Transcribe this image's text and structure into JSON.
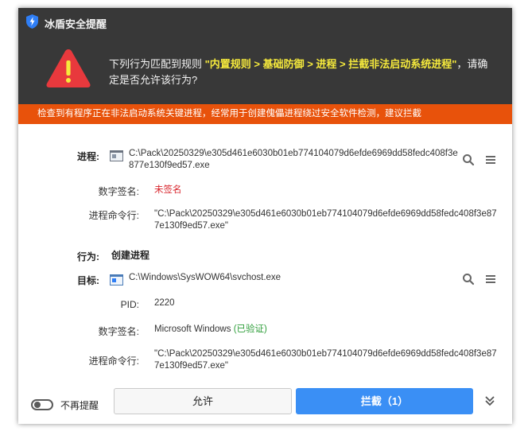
{
  "window": {
    "title": "冰盾安全提醒"
  },
  "header": {
    "msg_before": "下列行为匹配到规则 ",
    "rule": "\"内置规则 > 基础防御 > 进程 > 拦截非法启动系统进程\"",
    "msg_after": "，请确定是否允许该行为?"
  },
  "banner": {
    "text": "检查到有程序正在非法启动系统关键进程，经常用于创建傀儡进程绕过安全软件检测，建议拦截"
  },
  "process": {
    "label": "进程:",
    "path": "C:\\Pack\\20250329\\e305d461e6030b01eb774104079d6efde6969dd58fedc408f3e877e130f9ed57.exe",
    "sig_label": "数字签名:",
    "sig_value": "未签名",
    "cmd_label": "进程命令行:",
    "cmd_value": "\"C:\\Pack\\20250329\\e305d461e6030b01eb774104079d6efde6969dd58fedc408f3e877e130f9ed57.exe\""
  },
  "action": {
    "label": "行为:",
    "value": "创建进程"
  },
  "target": {
    "label": "目标:",
    "path": "C:\\Windows\\SysWOW64\\svchost.exe",
    "pid_label": "PID:",
    "pid_value": "2220",
    "sig_label": "数字签名:",
    "sig_value": "Microsoft Windows ",
    "sig_verified": "(已验证)",
    "cmd_label": "进程命令行:",
    "cmd_value": "\"C:\\Pack\\20250329\\e305d461e6030b01eb774104079d6efde6969dd58fedc408f3e877e130f9ed57.exe\""
  },
  "footer": {
    "toggle_label": "不再提醒",
    "allow_label": "允许",
    "block_label": "拦截（1）"
  },
  "icons": {
    "logo": "shield-bolt-icon",
    "warning": "warning-triangle-icon",
    "search": "search-icon",
    "menu": "menu-icon",
    "expand": "double-chevron-down-icon"
  },
  "colors": {
    "header_bg": "#383838",
    "banner_bg": "#e8520b",
    "rule_text": "#f5e93c",
    "warning_red": "#e8393d",
    "primary_button": "#3a8ff5",
    "unsigned_red": "#d8262d",
    "verified_green": "#2e9e3a"
  }
}
